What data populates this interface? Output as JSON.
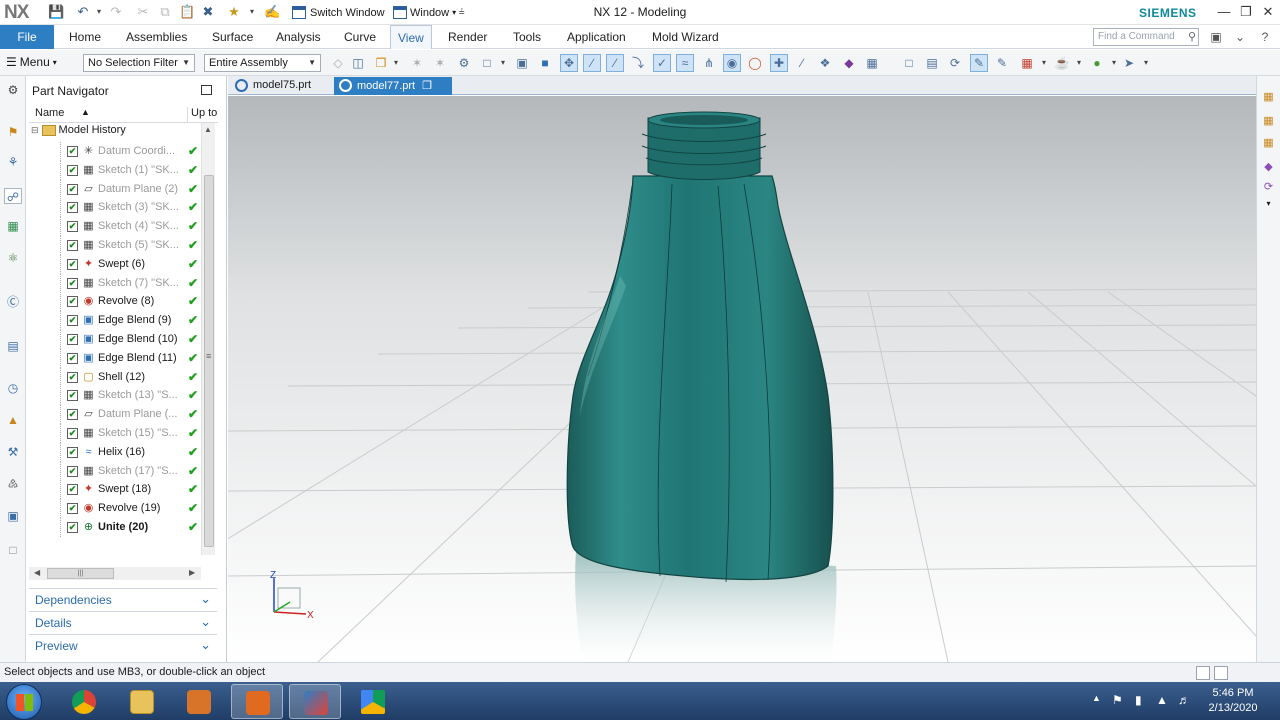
{
  "titlebar": {
    "app_logo": "NX",
    "switch_window": "Switch Window",
    "window_menu": "Window",
    "title": "NX 12 - Modeling",
    "brand": "SIEMENS"
  },
  "ribbon": {
    "file": "File",
    "tabs": [
      "Home",
      "Assemblies",
      "Surface",
      "Analysis",
      "Curve",
      "View",
      "Render",
      "Tools",
      "Application",
      "Mold Wizard"
    ],
    "active_tab": "View",
    "find_command_placeholder": "Find a Command"
  },
  "toolbar": {
    "menu": "Menu",
    "selection_filter": "No Selection Filter",
    "assembly_scope": "Entire Assembly"
  },
  "navigator": {
    "title": "Part Navigator",
    "col_name": "Name",
    "col_upto": "Up to",
    "root": "Model History",
    "features": [
      {
        "label": "Datum Coordi...",
        "dim": true,
        "icon": "datum-csys-icon"
      },
      {
        "label": "Sketch (1) \"SK...",
        "dim": true,
        "icon": "sketch-icon"
      },
      {
        "label": "Datum Plane (2)",
        "dim": true,
        "icon": "datum-plane-icon"
      },
      {
        "label": "Sketch (3) \"SK...",
        "dim": true,
        "icon": "sketch-icon"
      },
      {
        "label": "Sketch (4) \"SK...",
        "dim": true,
        "icon": "sketch-icon"
      },
      {
        "label": "Sketch (5) \"SK...",
        "dim": true,
        "icon": "sketch-icon"
      },
      {
        "label": "Swept (6)",
        "dim": false,
        "icon": "swept-icon"
      },
      {
        "label": "Sketch (7) \"SK...",
        "dim": true,
        "icon": "sketch-icon"
      },
      {
        "label": "Revolve (8)",
        "dim": false,
        "icon": "revolve-icon"
      },
      {
        "label": "Edge Blend (9)",
        "dim": false,
        "icon": "edge-blend-icon"
      },
      {
        "label": "Edge Blend (10)",
        "dim": false,
        "icon": "edge-blend-icon"
      },
      {
        "label": "Edge Blend (11)",
        "dim": false,
        "icon": "edge-blend-icon"
      },
      {
        "label": "Shell (12)",
        "dim": false,
        "icon": "shell-icon"
      },
      {
        "label": "Sketch (13) \"S...",
        "dim": true,
        "icon": "sketch-icon"
      },
      {
        "label": "Datum Plane (...",
        "dim": true,
        "icon": "datum-plane-icon"
      },
      {
        "label": "Sketch (15) \"S...",
        "dim": true,
        "icon": "sketch-icon"
      },
      {
        "label": "Helix (16)",
        "dim": false,
        "icon": "helix-icon"
      },
      {
        "label": "Sketch (17) \"S...",
        "dim": true,
        "icon": "sketch-icon"
      },
      {
        "label": "Swept (18)",
        "dim": false,
        "icon": "swept-icon"
      },
      {
        "label": "Revolve (19)",
        "dim": false,
        "icon": "revolve-icon"
      },
      {
        "label": "Unite (20)",
        "dim": false,
        "bold": true,
        "icon": "unite-icon"
      }
    ],
    "panels": [
      "Dependencies",
      "Details",
      "Preview"
    ]
  },
  "doc_tabs": [
    {
      "label": "model75.prt",
      "active": false
    },
    {
      "label": "model77.prt",
      "active": true
    }
  ],
  "viewport": {
    "triad_z": "Z",
    "triad_x": "X",
    "model_color": "#1f7a78"
  },
  "status": {
    "message": "Select objects and use MB3, or double-click an object"
  },
  "taskbar": {
    "time": "5:46 PM",
    "date": "2/13/2020"
  }
}
